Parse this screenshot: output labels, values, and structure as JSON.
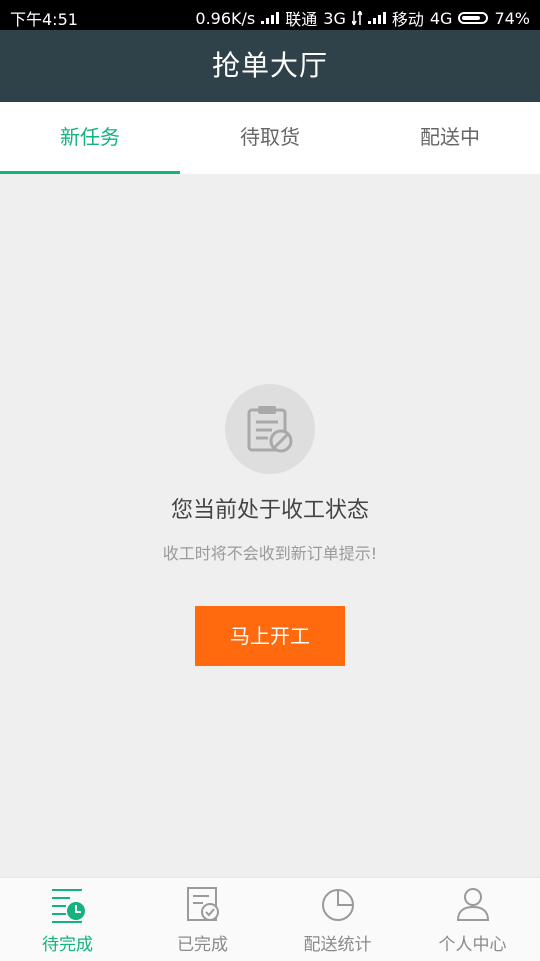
{
  "status_bar": {
    "time": "下午4:51",
    "speed": "0.96K/s",
    "carrier1": "联通",
    "net1": "3G",
    "carrier2": "移动",
    "net2": "4G",
    "battery": "74%"
  },
  "header": {
    "title": "抢单大厅"
  },
  "tabs": [
    {
      "label": "新任务",
      "active": true
    },
    {
      "label": "待取货",
      "active": false
    },
    {
      "label": "配送中",
      "active": false
    }
  ],
  "empty_state": {
    "icon": "clipboard-disabled-icon",
    "title": "您当前处于收工状态",
    "subtitle": "收工时将不会收到新订单提示!",
    "button_label": "马上开工"
  },
  "bottom_nav": [
    {
      "label": "待完成",
      "icon": "pending-list-icon",
      "active": true
    },
    {
      "label": "已完成",
      "icon": "completed-doc-icon",
      "active": false
    },
    {
      "label": "配送统计",
      "icon": "pie-chart-icon",
      "active": false
    },
    {
      "label": "个人中心",
      "icon": "user-icon",
      "active": false
    }
  ],
  "colors": {
    "header_bg": "#2f4249",
    "accent": "#13b37b",
    "button": "#ff6a0e",
    "background": "#efefef"
  }
}
